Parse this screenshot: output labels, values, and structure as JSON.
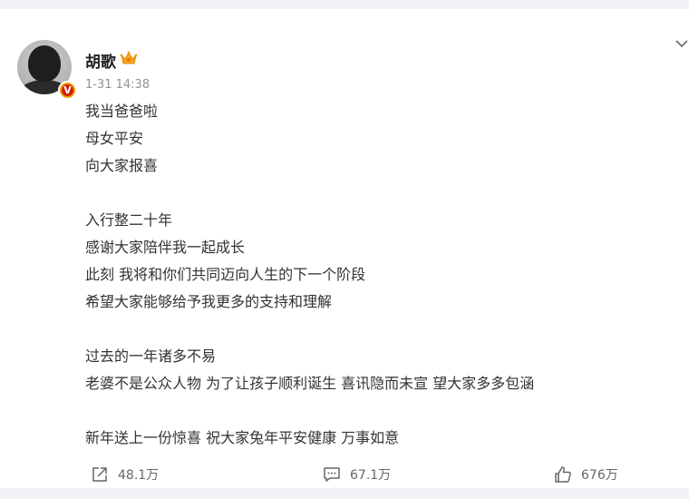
{
  "post": {
    "author": "胡歌",
    "time": "1-31 14:38",
    "verified_badge": "V",
    "lines": [
      "我当爸爸啦",
      "母女平安",
      "向大家报喜",
      "",
      "入行整二十年",
      "感谢大家陪伴我一起成长",
      "此刻 我将和你们共同迈向人生的下一个阶段",
      "希望大家能够给予我更多的支持和理解",
      "",
      "过去的一年诸多不易",
      "老婆不是公众人物 为了让孩子顺利诞生 喜讯隐而未宣 望大家多多包涵",
      "",
      "新年送上一份惊喜 祝大家兔年平安健康 万事如意"
    ]
  },
  "actions": {
    "repost_count": "48.1万",
    "comment_count": "67.1万",
    "like_count": "676万"
  },
  "icons": {
    "crown": "crown-icon",
    "verified": "verified-badge-icon",
    "more": "chevron-down-icon",
    "repost": "repost-icon",
    "comment": "comment-icon",
    "like": "thumbs-up-icon"
  },
  "colors": {
    "page_background": "#f1f2f5",
    "card_background": "#ffffff",
    "verified_badge": "#d81e06",
    "crown": "#f5a623",
    "muted_text": "#939393"
  }
}
